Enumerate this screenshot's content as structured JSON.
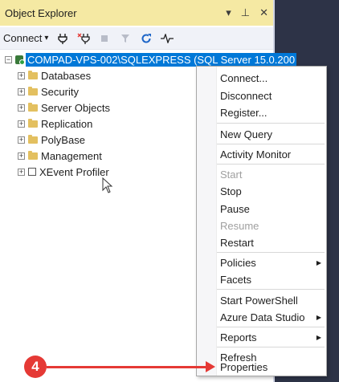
{
  "panel": {
    "title": "Object Explorer",
    "controls": {
      "dropdown": "▾",
      "pin": "⊥",
      "close": "✕"
    }
  },
  "toolbar": {
    "connect_label": "Connect",
    "connect_arrow": "▾"
  },
  "tree": {
    "root": "COMPAD-VPS-002\\SQLEXPRESS (SQL Server 15.0.200",
    "children": [
      {
        "label": "Databases",
        "icon": "folder-icon"
      },
      {
        "label": "Security",
        "icon": "folder-icon"
      },
      {
        "label": "Server Objects",
        "icon": "folder-icon"
      },
      {
        "label": "Replication",
        "icon": "folder-icon"
      },
      {
        "label": "PolyBase",
        "icon": "folder-icon"
      },
      {
        "label": "Management",
        "icon": "folder-icon"
      },
      {
        "label": "XEvent Profiler",
        "icon": "xevent-icon"
      }
    ]
  },
  "context_menu": {
    "items": [
      {
        "label": "Connect..."
      },
      {
        "label": "Disconnect"
      },
      {
        "label": "Register..."
      },
      {
        "label": "New Query"
      },
      {
        "label": "Activity Monitor"
      },
      {
        "label": "Start"
      },
      {
        "label": "Stop"
      },
      {
        "label": "Pause"
      },
      {
        "label": "Resume"
      },
      {
        "label": "Restart"
      },
      {
        "label": "Policies"
      },
      {
        "label": "Facets"
      },
      {
        "label": "Start PowerShell"
      },
      {
        "label": "Azure Data Studio"
      },
      {
        "label": "Reports"
      },
      {
        "label": "Refresh"
      },
      {
        "label": "Properties"
      }
    ]
  },
  "annotation": {
    "step_number": "4"
  },
  "colors": {
    "title_bg": "#f5e9a3",
    "selection": "#0078d7",
    "annotation": "#e53935",
    "folder": "#e3c060"
  }
}
